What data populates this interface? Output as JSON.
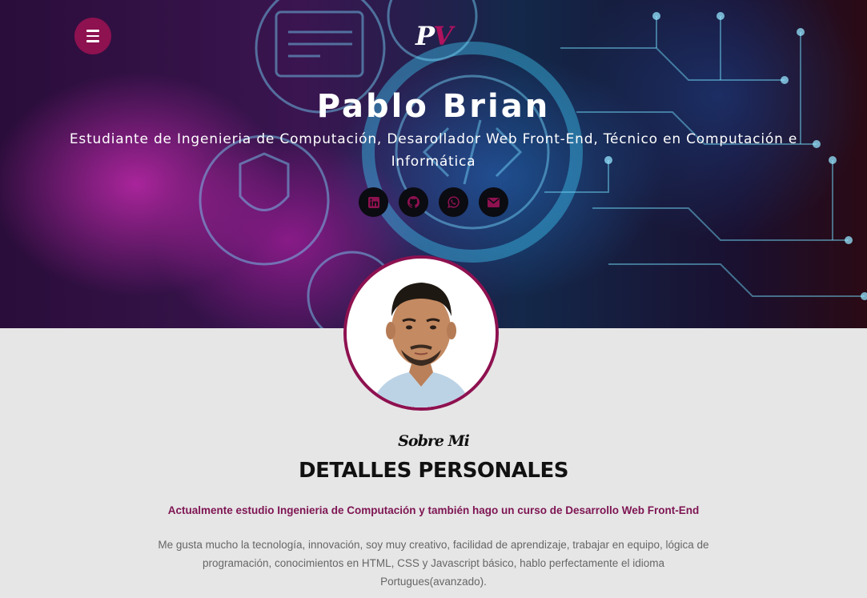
{
  "header": {
    "logo_p": "P",
    "logo_v": "V",
    "name": "Pablo Brian",
    "tagline": "Estudiante de Ingenieria de Computación, Desarollador Web Front-End, Técnico en Computación e Informática",
    "socials": [
      {
        "icon": "linkedin-icon"
      },
      {
        "icon": "github-icon"
      },
      {
        "icon": "whatsapp-icon"
      },
      {
        "icon": "envelope-icon"
      }
    ]
  },
  "about": {
    "kicker": "Sobre Mi",
    "heading": "DETALLES PERSONALES",
    "lead": "Actualmente estudio Ingenieria de Computación y también hago un curso de Desarrollo Web Front-End",
    "body": "Me gusta mucho la tecnología, innovación, soy muy creativo, facilidad de aprendizaje, trabajar en equipo, lógica de programación, conocimientos en HTML, CSS y Javascript básico, hablo perfectamente el idioma Portugues(avanzado)."
  },
  "colors": {
    "accent": "#8e1150",
    "lead_text": "#7e1553",
    "page_bg": "#e6e6e6",
    "social_bg": "#0b0b12"
  }
}
